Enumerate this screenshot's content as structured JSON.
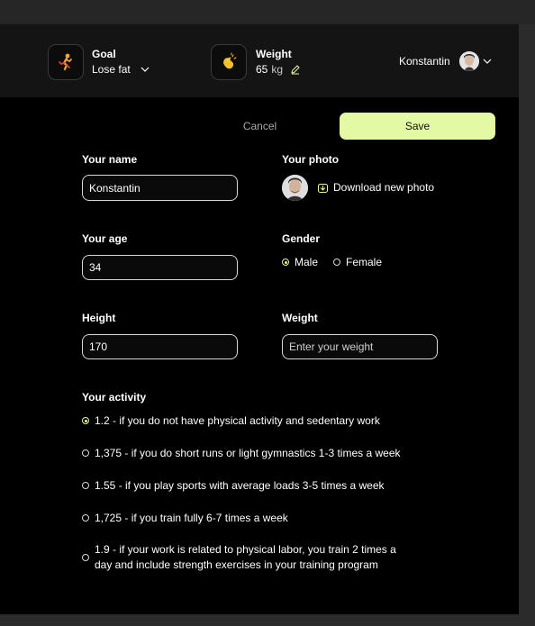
{
  "header": {
    "goal": {
      "label": "Goal",
      "value": "Lose fat",
      "icon": "runner-icon"
    },
    "weight": {
      "label": "Weight",
      "value": "65",
      "unit": "kg",
      "icon": "clap-icon"
    },
    "user": {
      "name": "Konstantin"
    }
  },
  "actions": {
    "cancel": "Cancel",
    "save": "Save"
  },
  "form": {
    "name": {
      "label": "Your name",
      "value": "Konstantin"
    },
    "photo": {
      "label": "Your photo",
      "action": "Download new photo"
    },
    "age": {
      "label": "Your age",
      "value": "34"
    },
    "gender": {
      "label": "Gender",
      "options": [
        "Male",
        "Female"
      ],
      "selected": "Male"
    },
    "height": {
      "label": "Height",
      "value": "170"
    },
    "weight": {
      "label": "Weight",
      "placeholder": "Enter your weight"
    },
    "activity": {
      "label": "Your activity",
      "selected_index": 0,
      "options": [
        {
          "line1": "1.2 - if you do not have physical activity and sedentary work"
        },
        {
          "line1": "1,375 - if you do short runs or light gymnastics 1-3 times a week"
        },
        {
          "line1": "1.55 - if you play sports with average loads 3-5 times a week"
        },
        {
          "line1": "1,725 - if you train fully 6-7 times a week"
        },
        {
          "line1": "1.9 - if your work is related to physical labor, you train 2 times a",
          "line2": "day and include strength exercises in your training program"
        }
      ]
    }
  },
  "colors": {
    "accent": "#e3f9a3",
    "background": "#000000",
    "header": "#141414"
  }
}
